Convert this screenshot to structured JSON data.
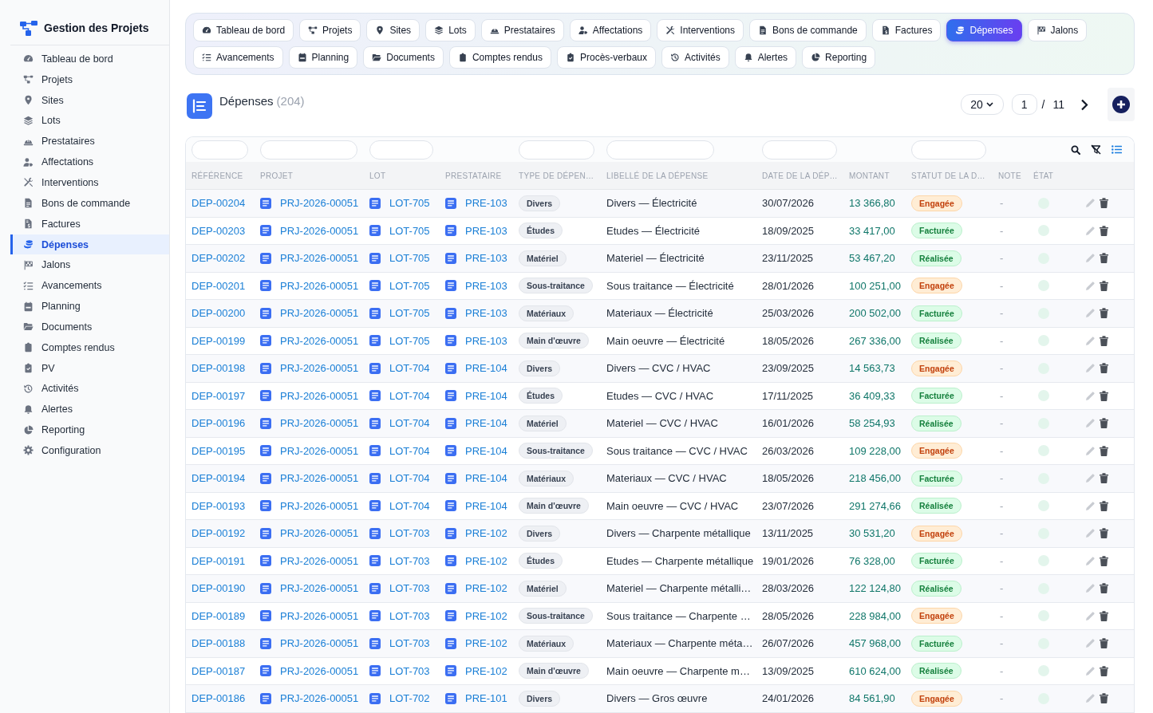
{
  "sidebar": {
    "title": "Gestion des Projets",
    "items": [
      {
        "label": "Tableau de bord",
        "selected": false
      },
      {
        "label": "Projets",
        "selected": false
      },
      {
        "label": "Sites",
        "selected": false
      },
      {
        "label": "Lots",
        "selected": false
      },
      {
        "label": "Prestataires",
        "selected": false
      },
      {
        "label": "Affectations",
        "selected": false
      },
      {
        "label": "Interventions",
        "selected": false
      },
      {
        "label": "Bons de commande",
        "selected": false
      },
      {
        "label": "Factures",
        "selected": false
      },
      {
        "label": "Dépenses",
        "selected": true
      },
      {
        "label": "Jalons",
        "selected": false
      },
      {
        "label": "Avancements",
        "selected": false
      },
      {
        "label": "Planning",
        "selected": false
      },
      {
        "label": "Documents",
        "selected": false
      },
      {
        "label": "Comptes rendus",
        "selected": false
      },
      {
        "label": "PV",
        "selected": false
      },
      {
        "label": "Activités",
        "selected": false
      },
      {
        "label": "Alertes",
        "selected": false
      },
      {
        "label": "Reporting",
        "selected": false
      },
      {
        "label": "Configuration",
        "selected": false
      }
    ]
  },
  "tabs": [
    {
      "label": "Tableau de bord",
      "selected": false
    },
    {
      "label": "Projets",
      "selected": false
    },
    {
      "label": "Sites",
      "selected": false
    },
    {
      "label": "Lots",
      "selected": false
    },
    {
      "label": "Prestataires",
      "selected": false
    },
    {
      "label": "Affectations",
      "selected": false
    },
    {
      "label": "Interventions",
      "selected": false
    },
    {
      "label": "Bons de commande",
      "selected": false
    },
    {
      "label": "Factures",
      "selected": false
    },
    {
      "label": "Dépenses",
      "selected": true
    },
    {
      "label": "Jalons",
      "selected": false
    },
    {
      "label": "Avancements",
      "selected": false
    },
    {
      "label": "Planning",
      "selected": false
    },
    {
      "label": "Documents",
      "selected": false
    },
    {
      "label": "Comptes rendus",
      "selected": false
    },
    {
      "label": "Procès-verbaux",
      "selected": false
    },
    {
      "label": "Activités",
      "selected": false
    },
    {
      "label": "Alertes",
      "selected": false
    },
    {
      "label": "Reporting",
      "selected": false
    }
  ],
  "header": {
    "title": "Dépenses",
    "count": "(204)",
    "page_size": "20",
    "page": "1",
    "separator": "/",
    "page_count": "11"
  },
  "table": {
    "columns": [
      {
        "label": "RÉFÉRENCE",
        "filter": true
      },
      {
        "label": "PROJET",
        "filter": true
      },
      {
        "label": "LOT",
        "filter": true
      },
      {
        "label": "PRESTATAIRE",
        "filter": false
      },
      {
        "label": "TYPE DE DÉPEN…",
        "filter": true
      },
      {
        "label": "LIBELLÉ DE LA DÉPENSE",
        "filter": true
      },
      {
        "label": "DATE DE LA DÉP…",
        "filter": true
      },
      {
        "label": "MONTANT",
        "filter": false
      },
      {
        "label": "STATUT DE LA D…",
        "filter": true
      },
      {
        "label": "NOTE",
        "filter": false
      },
      {
        "label": "ÉTAT",
        "filter": false
      }
    ],
    "rows": [
      {
        "reference": "DEP-00204",
        "project": "PRJ-2026-00051",
        "lot": "LOT-705",
        "contractor": "PRE-103",
        "type": "Divers",
        "label": "Divers — Électricité",
        "date": "30/07/2026",
        "amount": "13 366,80",
        "status": {
          "label": "Engagée",
          "kind": "warning"
        },
        "note": "-"
      },
      {
        "reference": "DEP-00203",
        "project": "PRJ-2026-00051",
        "lot": "LOT-705",
        "contractor": "PRE-103",
        "type": "Études",
        "label": "Etudes — Électricité",
        "date": "18/09/2025",
        "amount": "33 417,00",
        "status": {
          "label": "Facturée",
          "kind": "success"
        },
        "note": "-"
      },
      {
        "reference": "DEP-00202",
        "project": "PRJ-2026-00051",
        "lot": "LOT-705",
        "contractor": "PRE-103",
        "type": "Matériel",
        "label": "Materiel — Électricité",
        "date": "23/11/2025",
        "amount": "53 467,20",
        "status": {
          "label": "Réalisée",
          "kind": "success"
        },
        "note": "-"
      },
      {
        "reference": "DEP-00201",
        "project": "PRJ-2026-00051",
        "lot": "LOT-705",
        "contractor": "PRE-103",
        "type": "Sous-traitance",
        "label": "Sous traitance — Électricité",
        "date": "28/01/2026",
        "amount": "100 251,00",
        "status": {
          "label": "Engagée",
          "kind": "warning"
        },
        "note": "-"
      },
      {
        "reference": "DEP-00200",
        "project": "PRJ-2026-00051",
        "lot": "LOT-705",
        "contractor": "PRE-103",
        "type": "Matériaux",
        "label": "Materiaux — Électricité",
        "date": "25/03/2026",
        "amount": "200 502,00",
        "status": {
          "label": "Facturée",
          "kind": "success"
        },
        "note": "-"
      },
      {
        "reference": "DEP-00199",
        "project": "PRJ-2026-00051",
        "lot": "LOT-705",
        "contractor": "PRE-103",
        "type": "Main d'œuvre",
        "label": "Main oeuvre — Électricité",
        "date": "18/05/2026",
        "amount": "267 336,00",
        "status": {
          "label": "Réalisée",
          "kind": "success"
        },
        "note": "-"
      },
      {
        "reference": "DEP-00198",
        "project": "PRJ-2026-00051",
        "lot": "LOT-704",
        "contractor": "PRE-104",
        "type": "Divers",
        "label": "Divers — CVC / HVAC",
        "date": "23/09/2025",
        "amount": "14 563,73",
        "status": {
          "label": "Engagée",
          "kind": "warning"
        },
        "note": "-"
      },
      {
        "reference": "DEP-00197",
        "project": "PRJ-2026-00051",
        "lot": "LOT-704",
        "contractor": "PRE-104",
        "type": "Études",
        "label": "Etudes — CVC / HVAC",
        "date": "17/11/2025",
        "amount": "36 409,33",
        "status": {
          "label": "Facturée",
          "kind": "success"
        },
        "note": "-"
      },
      {
        "reference": "DEP-00196",
        "project": "PRJ-2026-00051",
        "lot": "LOT-704",
        "contractor": "PRE-104",
        "type": "Matériel",
        "label": "Materiel — CVC / HVAC",
        "date": "16/01/2026",
        "amount": "58 254,93",
        "status": {
          "label": "Réalisée",
          "kind": "success"
        },
        "note": "-"
      },
      {
        "reference": "DEP-00195",
        "project": "PRJ-2026-00051",
        "lot": "LOT-704",
        "contractor": "PRE-104",
        "type": "Sous-traitance",
        "label": "Sous traitance — CVC / HVAC",
        "date": "26/03/2026",
        "amount": "109 228,00",
        "status": {
          "label": "Engagée",
          "kind": "warning"
        },
        "note": "-"
      },
      {
        "reference": "DEP-00194",
        "project": "PRJ-2026-00051",
        "lot": "LOT-704",
        "contractor": "PRE-104",
        "type": "Matériaux",
        "label": "Materiaux — CVC / HVAC",
        "date": "18/05/2026",
        "amount": "218 456,00",
        "status": {
          "label": "Facturée",
          "kind": "success"
        },
        "note": "-"
      },
      {
        "reference": "DEP-00193",
        "project": "PRJ-2026-00051",
        "lot": "LOT-704",
        "contractor": "PRE-104",
        "type": "Main d'œuvre",
        "label": "Main oeuvre — CVC / HVAC",
        "date": "23/07/2026",
        "amount": "291 274,66",
        "status": {
          "label": "Réalisée",
          "kind": "success"
        },
        "note": "-"
      },
      {
        "reference": "DEP-00192",
        "project": "PRJ-2026-00051",
        "lot": "LOT-703",
        "contractor": "PRE-102",
        "type": "Divers",
        "label": "Divers — Charpente métallique",
        "date": "13/11/2025",
        "amount": "30 531,20",
        "status": {
          "label": "Engagée",
          "kind": "warning"
        },
        "note": "-"
      },
      {
        "reference": "DEP-00191",
        "project": "PRJ-2026-00051",
        "lot": "LOT-703",
        "contractor": "PRE-102",
        "type": "Études",
        "label": "Etudes — Charpente métallique",
        "date": "19/01/2026",
        "amount": "76 328,00",
        "status": {
          "label": "Facturée",
          "kind": "success"
        },
        "note": "-"
      },
      {
        "reference": "DEP-00190",
        "project": "PRJ-2026-00051",
        "lot": "LOT-703",
        "contractor": "PRE-102",
        "type": "Matériel",
        "label": "Materiel — Charpente métalli…",
        "date": "28/03/2026",
        "amount": "122 124,80",
        "status": {
          "label": "Réalisée",
          "kind": "success"
        },
        "note": "-"
      },
      {
        "reference": "DEP-00189",
        "project": "PRJ-2026-00051",
        "lot": "LOT-703",
        "contractor": "PRE-102",
        "type": "Sous-traitance",
        "label": "Sous traitance — Charpente …",
        "date": "28/05/2026",
        "amount": "228 984,00",
        "status": {
          "label": "Engagée",
          "kind": "warning"
        },
        "note": "-"
      },
      {
        "reference": "DEP-00188",
        "project": "PRJ-2026-00051",
        "lot": "LOT-703",
        "contractor": "PRE-102",
        "type": "Matériaux",
        "label": "Materiaux — Charpente méta…",
        "date": "26/07/2026",
        "amount": "457 968,00",
        "status": {
          "label": "Facturée",
          "kind": "success"
        },
        "note": "-"
      },
      {
        "reference": "DEP-00187",
        "project": "PRJ-2026-00051",
        "lot": "LOT-703",
        "contractor": "PRE-102",
        "type": "Main d'œuvre",
        "label": "Main oeuvre — Charpente m…",
        "date": "13/09/2025",
        "amount": "610 624,00",
        "status": {
          "label": "Réalisée",
          "kind": "success"
        },
        "note": "-"
      },
      {
        "reference": "DEP-00186",
        "project": "PRJ-2026-00051",
        "lot": "LOT-702",
        "contractor": "PRE-101",
        "type": "Divers",
        "label": "Divers — Gros œuvre",
        "date": "24/01/2026",
        "amount": "84 561,90",
        "status": {
          "label": "Engagée",
          "kind": "warning"
        },
        "note": "-"
      }
    ]
  }
}
